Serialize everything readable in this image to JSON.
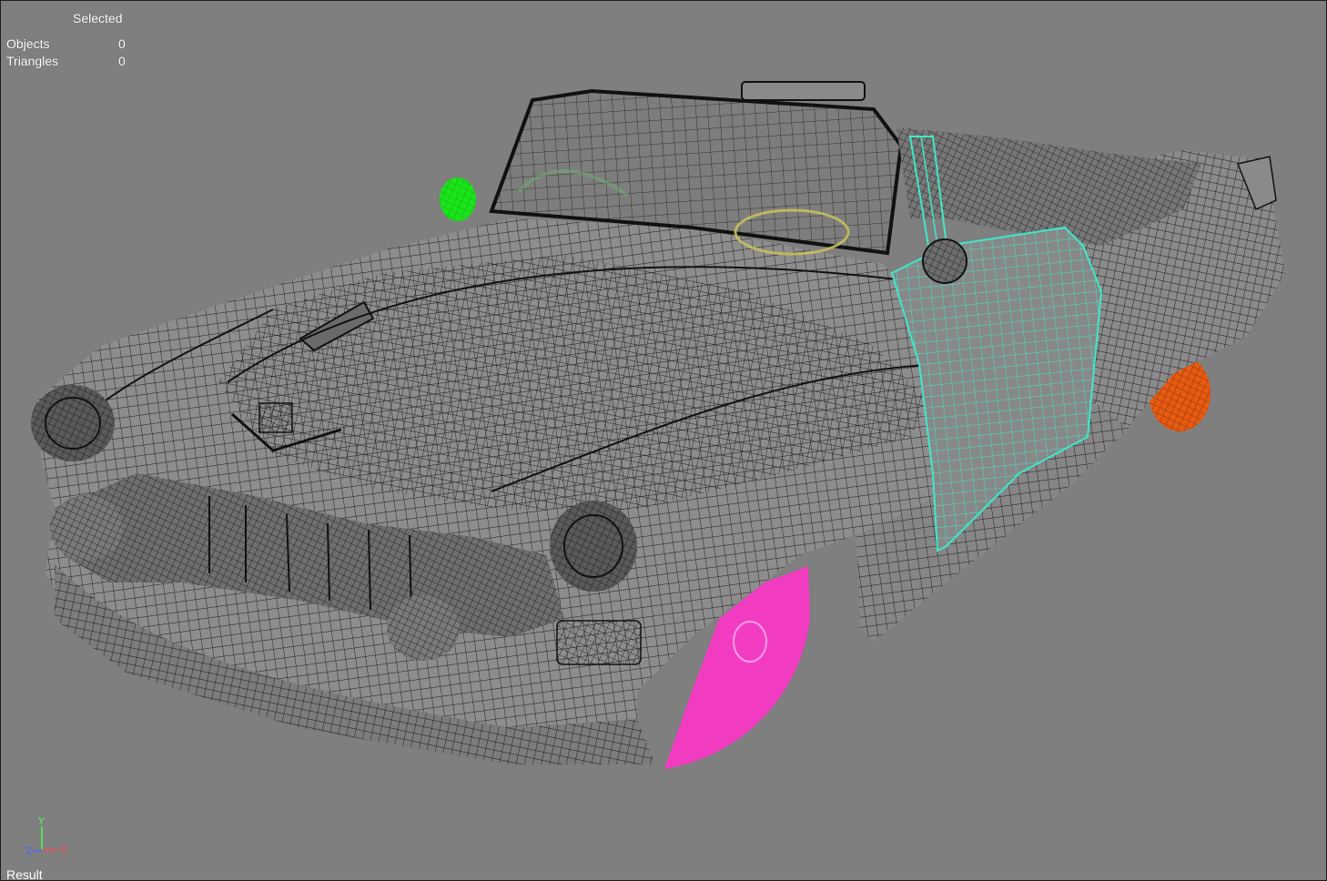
{
  "viewport": {
    "label": "Result",
    "background": "#7f7f7f"
  },
  "stats": {
    "header": "Selected",
    "rows": [
      {
        "label": "Objects",
        "value": "0"
      },
      {
        "label": "Triangles",
        "value": "0"
      }
    ]
  },
  "axis": {
    "x_label": "X",
    "y_label": "Y",
    "z_label": "Z",
    "x_color": "#ff4a4a",
    "y_color": "#4aff4a",
    "z_color": "#3f6bff"
  },
  "scene": {
    "object": "car-wireframe",
    "wire_color": "#151515",
    "highlights": {
      "door": "#3ee8c8",
      "front_wheel": "#ff3cc8",
      "rear_wheel": "#ff5a14",
      "mirror_marker": "#19e619",
      "steering_wheel": "#c9c35c"
    }
  }
}
